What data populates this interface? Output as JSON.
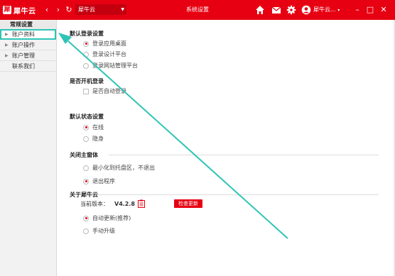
{
  "app": {
    "logo_text": "犀牛云",
    "logo_mark": "犀",
    "workspace_label": "犀牛云",
    "window_title": "系统设置",
    "user_name": "犀牛云..."
  },
  "sidebar": {
    "section_title": "常规设置",
    "items": [
      {
        "label": "账户资料"
      },
      {
        "label": "账户操作"
      },
      {
        "label": "账户管理"
      },
      {
        "label": "联系我们"
      }
    ]
  },
  "settings": {
    "login": {
      "title": "默认登录设置",
      "options": [
        "登录应用桌面",
        "登录设计平台",
        "登录网站管理平台"
      ],
      "selected": 0
    },
    "startup": {
      "title": "是否开机登录",
      "checkbox_label": "是否自动登录"
    },
    "status": {
      "title": "默认状态设置",
      "options": [
        "在线",
        "隐身"
      ],
      "selected": 0
    },
    "close": {
      "title": "关闭主窗体",
      "options": [
        "最小化到托盘区，不退出",
        "退出程序"
      ],
      "selected": 1
    },
    "about": {
      "title": "关于犀牛云",
      "version_label": "当前版本：",
      "version_value": "V4.2.8",
      "check_button": "检查更新",
      "options": [
        "自动更新(推荐)",
        "手动升级"
      ],
      "selected": 0
    }
  },
  "colors": {
    "brand_red": "#e60012",
    "annotation_teal": "#2ec4b6"
  },
  "icons": [
    "back-icon",
    "forward-icon",
    "refresh-icon",
    "home-icon",
    "mail-icon",
    "gear-icon",
    "user-icon",
    "minimize-icon",
    "maximize-icon",
    "close-icon",
    "clipboard-icon"
  ]
}
